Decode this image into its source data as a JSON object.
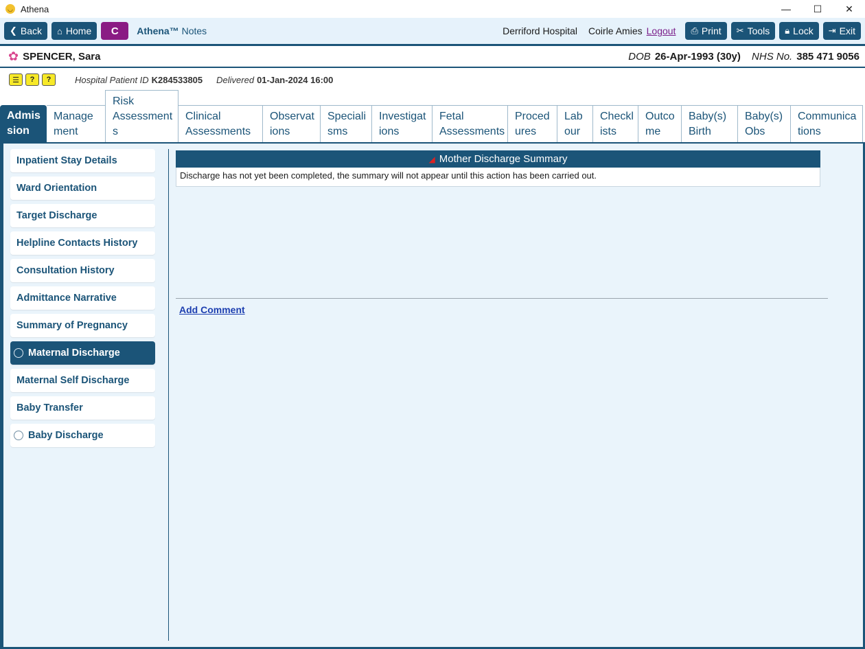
{
  "window": {
    "title": "Athena",
    "minimize": "—",
    "maximize": "☐",
    "close": "✕"
  },
  "toolbar": {
    "back": "Back",
    "home": "Home",
    "c_label": "C",
    "brand_name": "Athena™",
    "brand_suffix": "Notes",
    "hospital": "Derriford Hospital",
    "user": "Coirle Amies",
    "logout": "Logout",
    "print": "Print",
    "tools": "Tools",
    "lock": "Lock",
    "exit": "Exit"
  },
  "patient": {
    "name": "SPENCER, Sara",
    "dob_label": "DOB",
    "dob": "26-Apr-1993 (30y)",
    "nhs_label": "NHS No.",
    "nhs": "385 471 9056",
    "hospital_id_label": "Hospital Patient ID",
    "hospital_id": "K284533805",
    "delivered_label": "Delivered",
    "delivered": "01-Jan-2024 16:00"
  },
  "tabs": [
    {
      "l1": "Admis",
      "l2": "sion",
      "l3": ""
    },
    {
      "l1": "Manage",
      "l2": "ment",
      "l3": ""
    },
    {
      "l1": "Risk",
      "l2": "Assessment",
      "l3": "s"
    },
    {
      "l1": "Clinical",
      "l2": "Assessments",
      "l3": ""
    },
    {
      "l1": "Observat",
      "l2": "ions",
      "l3": ""
    },
    {
      "l1": "Speciali",
      "l2": "sms",
      "l3": ""
    },
    {
      "l1": "Investigat",
      "l2": "ions",
      "l3": ""
    },
    {
      "l1": "Fetal",
      "l2": "Assessments",
      "l3": ""
    },
    {
      "l1": "Proced",
      "l2": "ures",
      "l3": ""
    },
    {
      "l1": "Lab",
      "l2": "our",
      "l3": ""
    },
    {
      "l1": "Checkl",
      "l2": "ists",
      "l3": ""
    },
    {
      "l1": "Outco",
      "l2": "me",
      "l3": ""
    },
    {
      "l1": "Baby(s)",
      "l2": "Birth",
      "l3": ""
    },
    {
      "l1": "Baby(s)",
      "l2": "Obs",
      "l3": ""
    },
    {
      "l1": "Communica",
      "l2": "tions",
      "l3": ""
    }
  ],
  "sidebar": {
    "items": [
      {
        "label": "Inpatient Stay Details"
      },
      {
        "label": "Ward Orientation"
      },
      {
        "label": "Target Discharge"
      },
      {
        "label": "Helpline Contacts History"
      },
      {
        "label": "Consultation History"
      },
      {
        "label": "Admittance Narrative"
      },
      {
        "label": "Summary of Pregnancy"
      },
      {
        "label": "Maternal Discharge"
      },
      {
        "label": "Maternal Self Discharge"
      },
      {
        "label": "Baby Transfer"
      },
      {
        "label": "Baby Discharge"
      }
    ]
  },
  "panel": {
    "title": "Mother Discharge Summary",
    "message": "Discharge has not yet been completed, the summary will not appear until this action has been carried out.",
    "add_comment": "Add Comment"
  }
}
